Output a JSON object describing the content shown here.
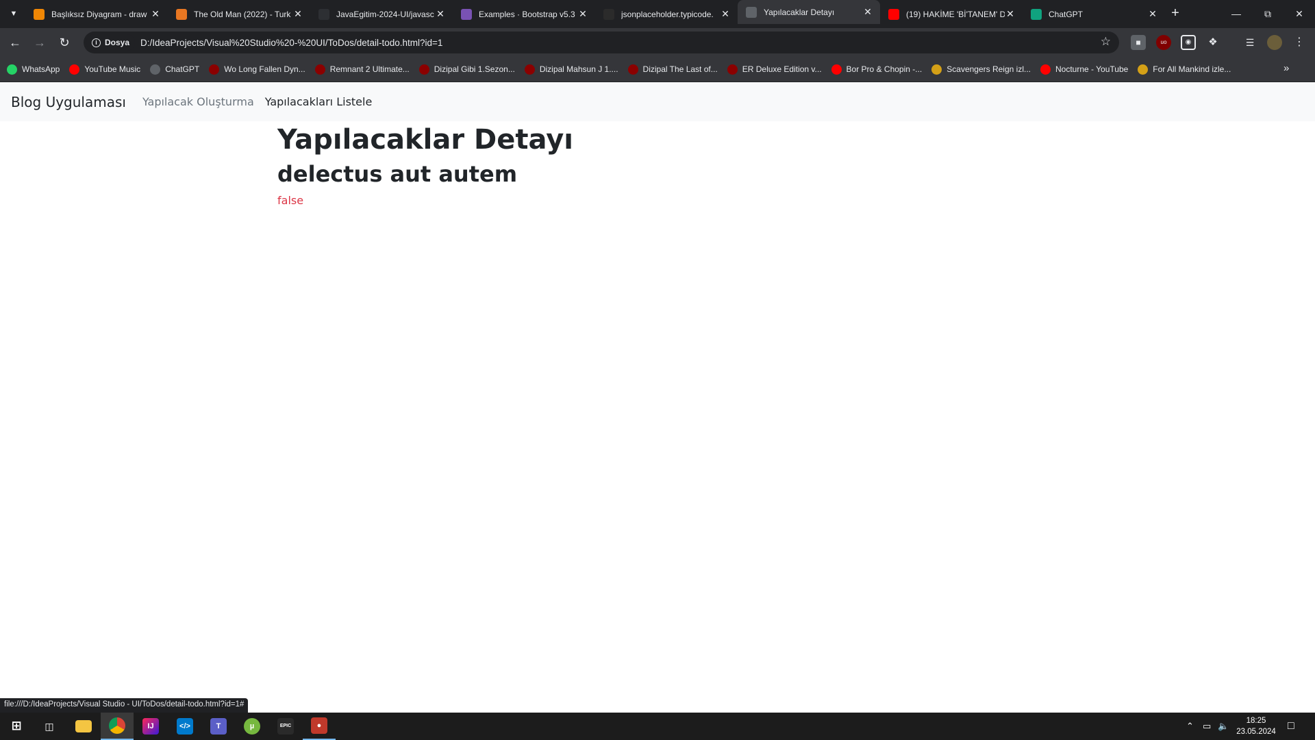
{
  "browser": {
    "tabs": [
      {
        "title": "Başlıksız Diyagram - draw",
        "favicon_color": "#f08705",
        "active": false
      },
      {
        "title": "The Old Man (2022) - Turk",
        "favicon_color": "#e87722",
        "active": false
      },
      {
        "title": "JavaEgitim-2024-UI/javasc",
        "favicon_color": "#2d2f33",
        "active": false
      },
      {
        "title": "Examples · Bootstrap v5.3",
        "favicon_color": "#7952b3",
        "active": false
      },
      {
        "title": "jsonplaceholder.typicode.",
        "favicon_color": "#2b2b2b",
        "active": false
      },
      {
        "title": "Yapılacaklar Detayı",
        "favicon_color": "#5f6368",
        "active": true
      },
      {
        "title": "(19) HAKİME 'Bİ'TANEM' D",
        "favicon_color": "#ff0000",
        "active": false
      },
      {
        "title": "ChatGPT",
        "favicon_color": "#10a37f",
        "active": false
      }
    ],
    "address": {
      "chip": "Dosya",
      "url": "D:/IdeaProjects/Visual%20Studio%20-%20UI/ToDos/detail-todo.html?id=1"
    },
    "bookmarks": [
      {
        "label": "WhatsApp",
        "color": "#25d366"
      },
      {
        "label": "YouTube Music",
        "color": "#ff0000"
      },
      {
        "label": "ChatGPT",
        "color": "#5f6368"
      },
      {
        "label": "Wo Long Fallen Dyn...",
        "color": "#8b0000"
      },
      {
        "label": "Remnant 2 Ultimate...",
        "color": "#8b0000"
      },
      {
        "label": "Dizipal Gibi 1.Sezon...",
        "color": "#8b0000"
      },
      {
        "label": "Dizipal Mahsun J 1....",
        "color": "#8b0000"
      },
      {
        "label": "Dizipal The Last of...",
        "color": "#8b0000"
      },
      {
        "label": "ER Deluxe Edition v...",
        "color": "#8b0000"
      },
      {
        "label": "Bor Pro & Chopin -...",
        "color": "#ff0000"
      },
      {
        "label": "Scavengers Reign izl...",
        "color": "#d4a017"
      },
      {
        "label": "Nocturne - YouTube",
        "color": "#ff0000"
      },
      {
        "label": "For All Mankind izle...",
        "color": "#d4a017"
      }
    ],
    "status_link": "file:///D:/IdeaProjects/Visual Studio - UI/ToDos/detail-todo.html?id=1#"
  },
  "page": {
    "navbar": {
      "brand": "Blog Uygulaması",
      "links": [
        {
          "label": "Yapılacak Oluşturma",
          "muted": true
        },
        {
          "label": "Yapılacakları Listele",
          "muted": false
        }
      ]
    },
    "heading": "Yapılacaklar Detayı",
    "todo_title": "delectus aut autem",
    "completed": "false",
    "status_color": "#dc3545"
  },
  "taskbar": {
    "apps": [
      "start-icon",
      "task-view-icon",
      "file-explorer-icon",
      "chrome-icon",
      "intellij-icon",
      "vscode-icon",
      "teams-icon",
      "utorrent-icon",
      "epic-games-icon",
      "app-icon"
    ],
    "time": "18:25",
    "date": "23.05.2024"
  }
}
